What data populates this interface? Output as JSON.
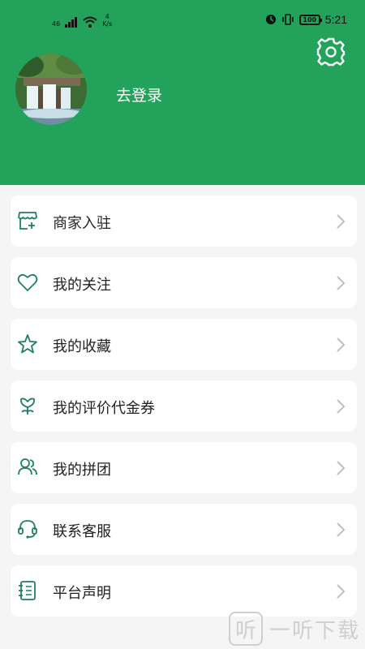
{
  "status_bar": {
    "signal_label": "46",
    "net_speed_value": "4",
    "net_speed_unit": "K/s",
    "battery": "100",
    "time": "5:21"
  },
  "profile": {
    "login_text": "去登录"
  },
  "menu": {
    "items": [
      {
        "label": "商家入驻",
        "icon": "store-icon"
      },
      {
        "label": "我的关注",
        "icon": "heart-icon"
      },
      {
        "label": "我的收藏",
        "icon": "star-icon"
      },
      {
        "label": "我的评价代金券",
        "icon": "flower-icon"
      },
      {
        "label": "我的拼团",
        "icon": "users-icon"
      },
      {
        "label": "联系客服",
        "icon": "headset-icon"
      },
      {
        "label": "平台声明",
        "icon": "notebook-icon"
      }
    ]
  },
  "watermark": {
    "badge": "听",
    "text": "一听下载"
  },
  "colors": {
    "header_green": "#22a25a",
    "icon_teal": "#1e7f66",
    "background": "#f5f5f5"
  }
}
